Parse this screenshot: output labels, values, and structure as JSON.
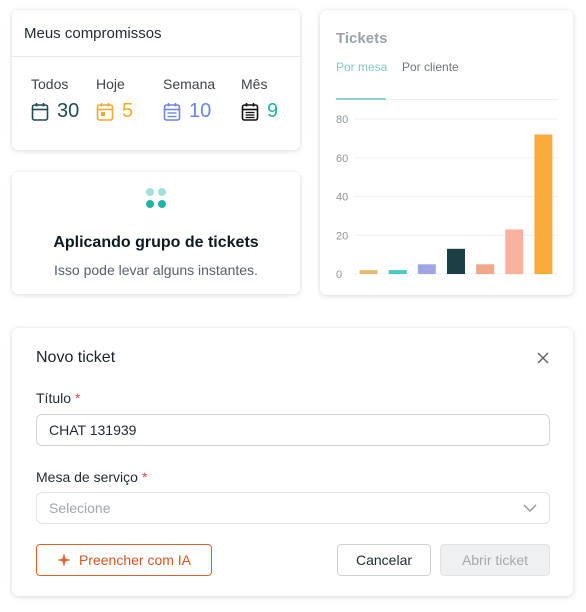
{
  "commitments": {
    "title": "Meus compromissos",
    "periods": [
      {
        "label": "Todos",
        "value": "30",
        "color": "#1f4b55"
      },
      {
        "label": "Hoje",
        "value": "5",
        "color": "#f2a82c"
      },
      {
        "label": "Semana",
        "value": "10",
        "color": "#6d86e0"
      },
      {
        "label": "Mês",
        "value": "9",
        "color": "#1fb5a0"
      }
    ]
  },
  "applying": {
    "heading": "Aplicando grupo de tickets",
    "subtext": "Isso pode levar alguns instantes."
  },
  "tickets": {
    "title": "Tickets",
    "tabs": [
      {
        "label": "Por mesa",
        "active": true
      },
      {
        "label": "Por cliente",
        "active": false
      }
    ]
  },
  "chart_data": {
    "type": "bar",
    "title": "Tickets",
    "categories": [
      "",
      "",
      "",
      "",
      "",
      "",
      ""
    ],
    "values": [
      2,
      2,
      5,
      13,
      5,
      23,
      72
    ],
    "colors": [
      "#e8b970",
      "#48ccbf",
      "#9fa6e6",
      "#1c3f45",
      "#f2a789",
      "#f8b29d",
      "#f9ab3b"
    ],
    "yticks": [
      "0",
      "20",
      "40",
      "60",
      "80"
    ],
    "ylim": [
      0,
      80
    ],
    "grid": true
  },
  "modal": {
    "title": "Novo ticket",
    "title_label": "Título",
    "title_value": "CHAT 131939",
    "desk_label": "Mesa de serviço",
    "desk_placeholder": "Selecione",
    "required_mark": "*",
    "ia_button": "Preencher com IA",
    "cancel_button": "Cancelar",
    "open_button": "Abrir ticket"
  }
}
